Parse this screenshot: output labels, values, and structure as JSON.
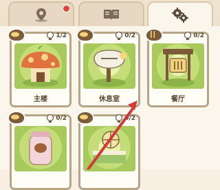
{
  "tabs": [
    {
      "icon": "map-pin-icon",
      "active": false,
      "notification": true
    },
    {
      "icon": "book-icon",
      "active": false,
      "notification": false
    },
    {
      "icon": "gears-icon",
      "active": true,
      "notification": false
    }
  ],
  "cards": [
    {
      "label": "主楼",
      "count": "1/2",
      "icon": "mushroom-house-icon"
    },
    {
      "label": "休息室",
      "count": "0/2",
      "icon": "rest-sign-icon"
    },
    {
      "label": "餐厅",
      "count": "0/2",
      "icon": "restaurant-sign-icon"
    },
    {
      "label": "",
      "count": "0/2",
      "icon": "jar-icon"
    },
    {
      "label": "",
      "count": "0/2",
      "icon": "bed-window-icon"
    }
  ],
  "colors": {
    "accent": "#b8a588",
    "tab_bg": "#e6d8c2",
    "notification": "#e2463b",
    "arrow": "#d23a3a"
  }
}
